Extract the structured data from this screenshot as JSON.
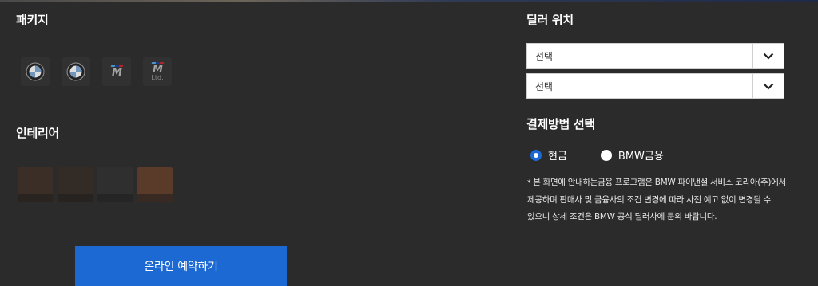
{
  "package": {
    "title": "패키지",
    "badges": [
      {
        "icon": "bmw-roundel-icon"
      },
      {
        "icon": "bmw-roundel-icon"
      },
      {
        "icon": "m-logo-icon",
        "text": "M"
      },
      {
        "icon": "m-ltd-logo-icon",
        "text": "M",
        "sub": "Ltd."
      }
    ]
  },
  "interior": {
    "title": "인테리어",
    "swatches": [
      {
        "color": "#3b2e27"
      },
      {
        "color": "#332b26"
      },
      {
        "color": "#2f2f2f"
      },
      {
        "color": "#5a3a28"
      }
    ]
  },
  "reserve": {
    "label": "온라인 예약하기"
  },
  "dealer": {
    "title": "딜러 위치",
    "select1": "선택",
    "select2": "선택"
  },
  "payment": {
    "title": "결제방법 선택",
    "options": [
      {
        "label": "현금",
        "checked": true
      },
      {
        "label": "BMW금융",
        "checked": false
      }
    ],
    "notice_bullet": "*",
    "notice": "본 화면에 안내하는금융 프로그램은 BMW 파이낸셜 서비스 코리아(주)에서 제공하며 판매사 및 금융사의 조건 변경에 따라 사전 예고 없이 변경될 수 있으니 상세 조건은 BMW 공식 딜러사에 문의 바랍니다."
  },
  "colors": {
    "background": "#2b2b2b",
    "accent": "#1c69d4",
    "m_stripes": [
      "#4fa8e6",
      "#1c3f94",
      "#d0202a"
    ]
  }
}
